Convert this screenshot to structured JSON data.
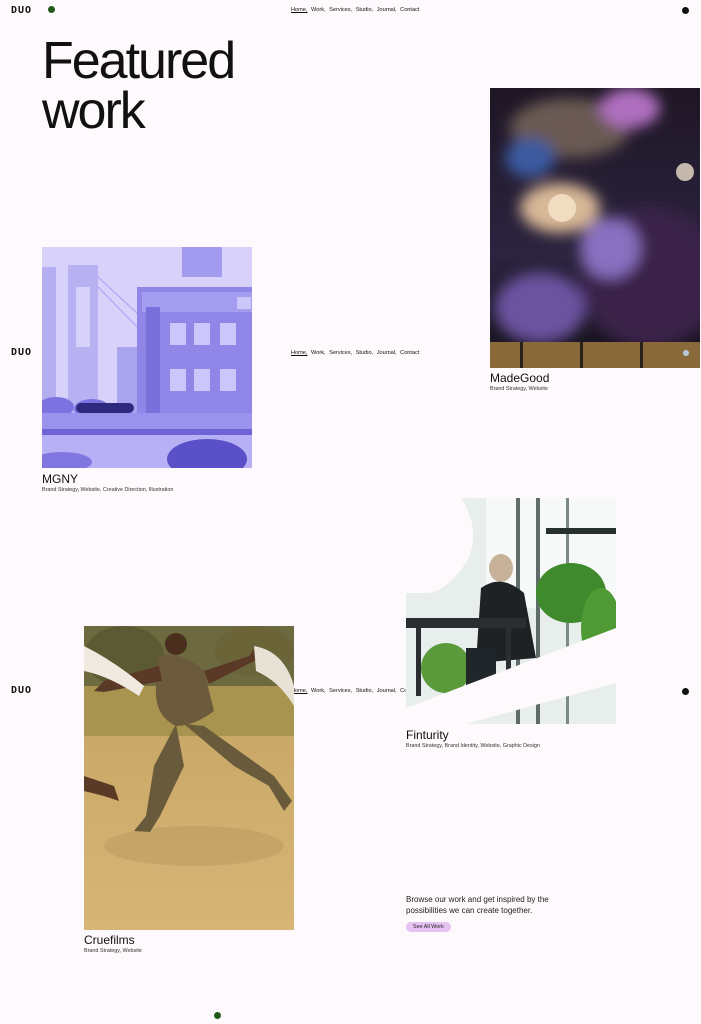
{
  "brand": {
    "logo": "DUO"
  },
  "nav": {
    "items": [
      "Home,",
      "Work,",
      "Services,",
      "Studio,",
      "Journal,",
      "Contact"
    ]
  },
  "heading": {
    "line1": "Featured",
    "line2": "work"
  },
  "projects": [
    {
      "name": "MadeGood",
      "tags": "Brand Strategy, Website"
    },
    {
      "name": "MGNY",
      "tags": "Brand Strategy, Website, Creative Direction, Illustration"
    },
    {
      "name": "Finturity",
      "tags": "Brand Strategy, Brand Identity, Website, Graphic Design"
    },
    {
      "name": "Cruefilms",
      "tags": "Brand Strategy, Website"
    }
  ],
  "cta": {
    "text": "Browse our work and get inspired by the possibilities we can create together.",
    "button": "See All Work"
  },
  "colors": {
    "background": "#fdf9fc",
    "accent_green": "#1f5a1b",
    "button": "#e6c2f2"
  }
}
